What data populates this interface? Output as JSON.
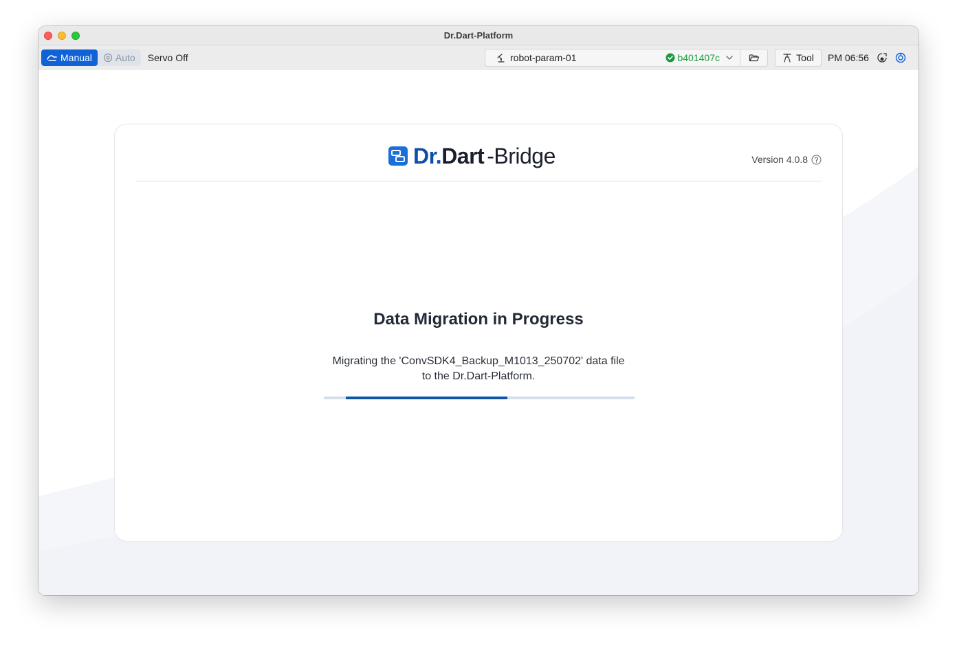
{
  "window": {
    "title": "Dr.Dart-Platform"
  },
  "toolbar": {
    "manual_label": "Manual",
    "auto_label": "Auto",
    "servo_label": "Servo Off",
    "param_name": "robot-param-01",
    "param_hash": "b401407c",
    "tool_label": "Tool",
    "time": "PM 06:56"
  },
  "card": {
    "logo": {
      "dr": "Dr",
      "dot": ".",
      "dart": "Dart",
      "dash": "-",
      "bridge": "Bridge"
    },
    "version": "Version 4.0.8",
    "heading": "Data Migration in Progress",
    "description_line1": "Migrating the 'ConvSDK4_Backup_M1013_250702' data file",
    "description_line2": "to the Dr.Dart-Platform.",
    "progress": {
      "start_fraction": 0.07,
      "end_fraction": 0.59
    }
  },
  "colors": {
    "accent": "#1062d6",
    "hash_ok": "#1c9b3e",
    "progress_fill": "#0d56a8",
    "progress_track": "#d4deea",
    "logo_blue": "#0d4fa8"
  },
  "icons": {
    "manual": "hand-wave-icon",
    "auto": "robot-auto-icon",
    "param": "robot-arm-icon",
    "hash_status": "check-circle-icon",
    "dropdown": "chevron-down-icon",
    "folder": "folder-open-icon",
    "tool": "tool-gripper-icon",
    "status1": "connection-status-icon",
    "status2": "sync-icon",
    "help": "help-circle-icon",
    "logo": "bridge-logo-icon"
  }
}
